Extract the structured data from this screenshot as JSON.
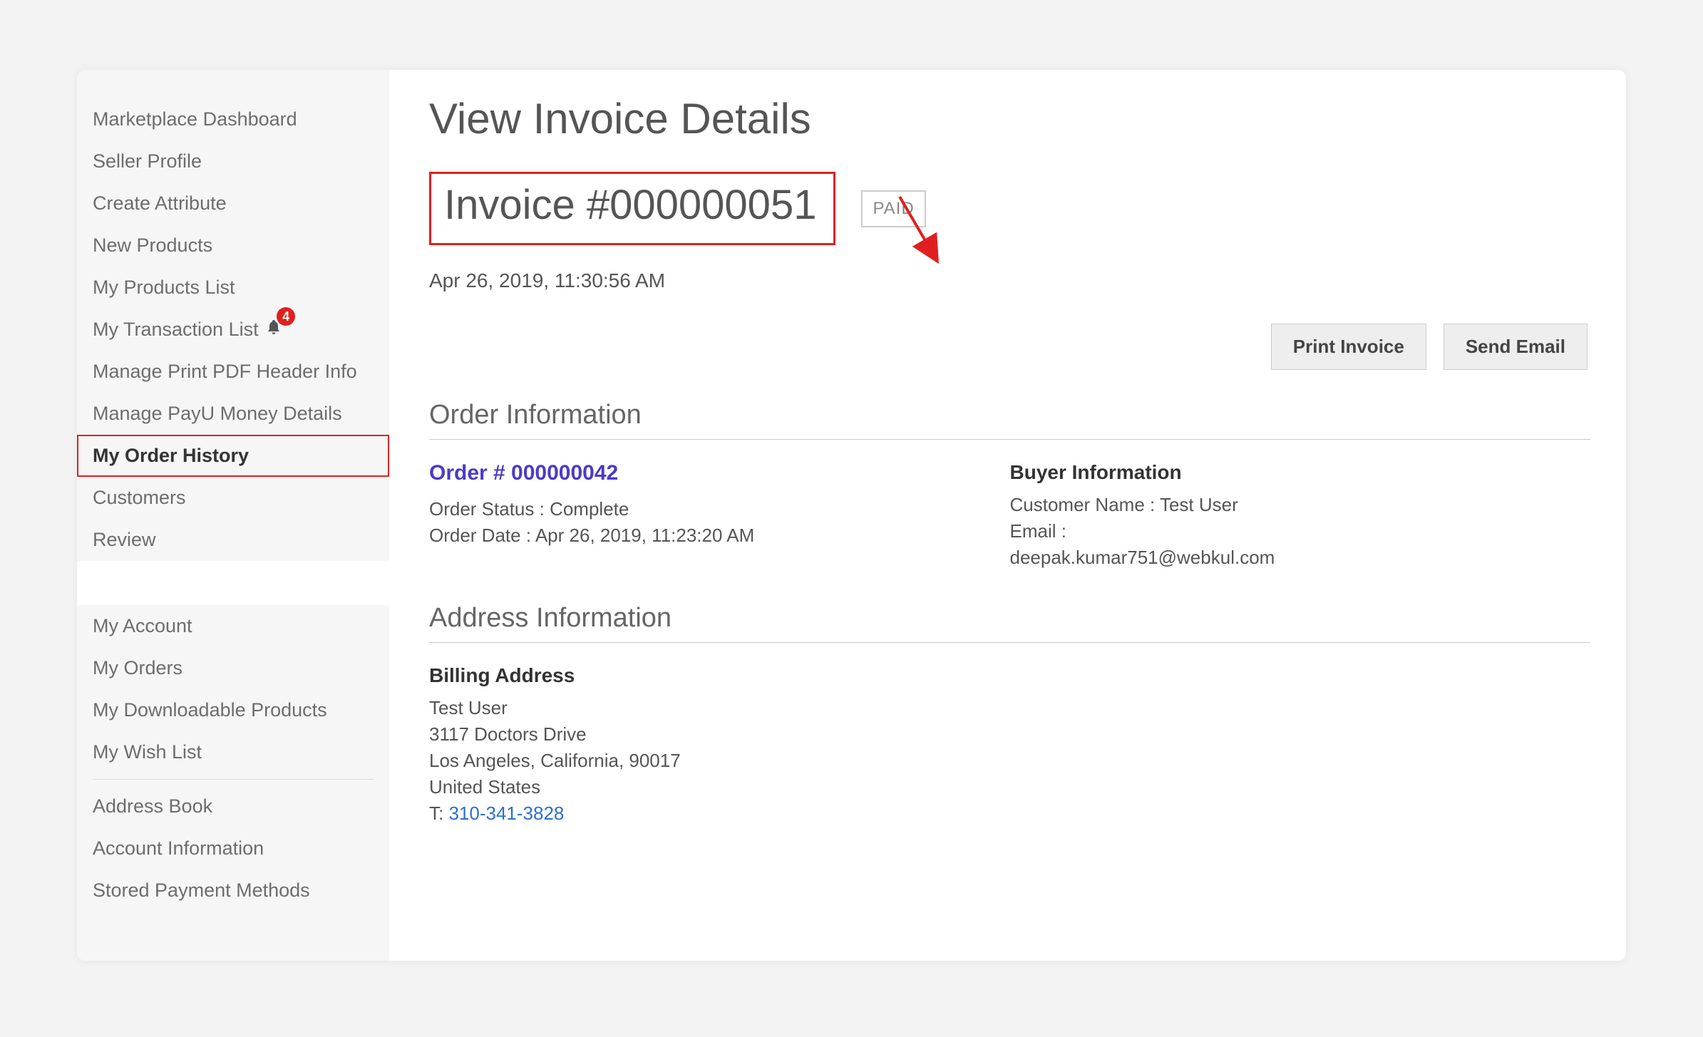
{
  "sidebar": {
    "group1": [
      {
        "label": "Marketplace Dashboard"
      },
      {
        "label": "Seller Profile"
      },
      {
        "label": "Create Attribute"
      },
      {
        "label": "New Products"
      },
      {
        "label": "My Products List"
      },
      {
        "label": "My Transaction List",
        "has_bell": true,
        "badge": "4"
      },
      {
        "label": "Manage Print PDF Header Info"
      },
      {
        "label": "Manage PayU Money Details"
      },
      {
        "label": "My Order History",
        "active": true
      },
      {
        "label": "Customers"
      },
      {
        "label": "Review"
      }
    ],
    "group2": [
      {
        "label": "My Account"
      },
      {
        "label": "My Orders"
      },
      {
        "label": "My Downloadable Products"
      },
      {
        "label": "My Wish List"
      }
    ],
    "group3": [
      {
        "label": "Address Book"
      },
      {
        "label": "Account Information"
      },
      {
        "label": "Stored Payment Methods"
      }
    ]
  },
  "page": {
    "title": "View Invoice Details",
    "invoice_label": "Invoice #000000051",
    "status_badge": "PAID",
    "invoice_date": "Apr 26, 2019, 11:30:56 AM",
    "print_btn": "Print Invoice",
    "send_email_btn": "Send Email"
  },
  "order_info": {
    "section_title": "Order Information",
    "order_link": "Order # 000000042",
    "order_status": "Order Status : Complete",
    "order_date": "Order Date : Apr 26, 2019, 11:23:20 AM",
    "buyer_heading": "Buyer Information",
    "customer_name": "Customer Name : Test User",
    "email_label": "Email :",
    "email_value": "deepak.kumar751@webkul.com"
  },
  "address_info": {
    "section_title": "Address Information",
    "billing_heading": "Billing Address",
    "name": "Test User",
    "line1": "3117 Doctors Drive",
    "line2": "Los Angeles, California, 90017",
    "country": "United States",
    "phone_prefix": "T: ",
    "phone": "310-341-3828"
  }
}
